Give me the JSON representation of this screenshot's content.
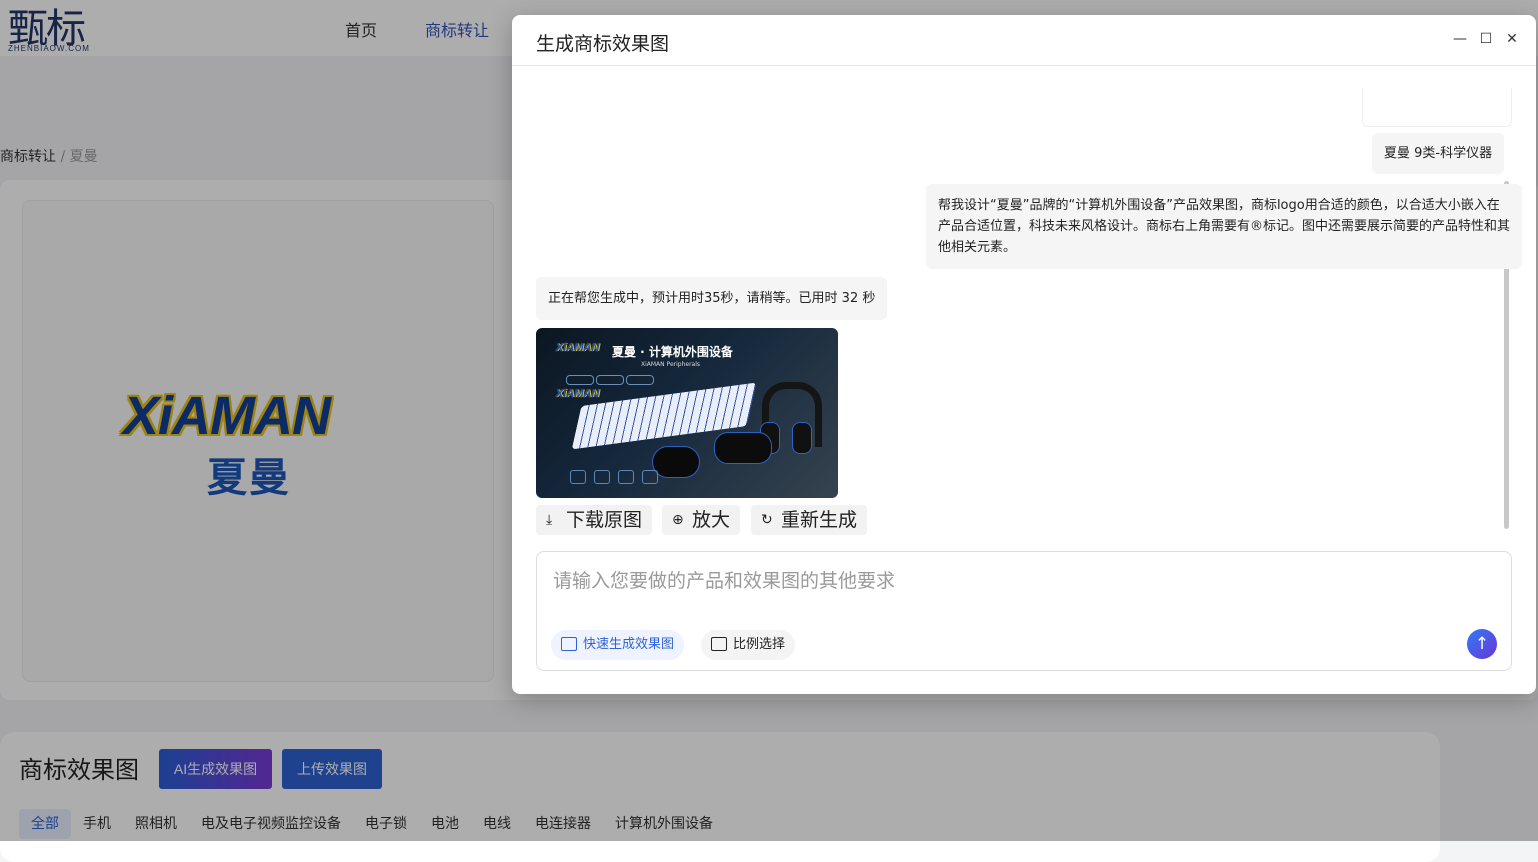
{
  "site": {
    "logo_cn": "甄标",
    "logo_en": "ZHENBIAOW.COM",
    "nav": [
      "首页",
      "商标转让"
    ],
    "breadcrumb": {
      "parent": "商标转让",
      "separator": "/",
      "current": "夏曼"
    },
    "brand_en": "XiAMAN",
    "brand_cn": "夏曼",
    "effects": {
      "title": "商标效果图",
      "ai_button": "AI生成效果图",
      "upload_button": "上传效果图",
      "categories": [
        "全部",
        "手机",
        "照相机",
        "电及电子视频监控设备",
        "电子锁",
        "电池",
        "电线",
        "电连接器",
        "计算机外围设备"
      ]
    }
  },
  "dialog": {
    "title": "生成商标效果图",
    "controls": {
      "minimize": "—",
      "maximize": "☐",
      "close": "✕"
    },
    "messages": {
      "category": "夏曼 9类-科学仪器",
      "request": "帮我设计“夏曼”品牌的“计算机外围设备”产品效果图，商标logo用合适的颜色，以合适大小嵌入在产品合适位置，科技未来风格设计。商标右上角需要有®标记。图中还需要展示简要的产品特性和其他相关元素。",
      "status": "正在帮您生成中，预计用时35秒，请稍等。已用时 32 秒"
    },
    "generated_image": {
      "logo_text": "XiAMAN",
      "title": "夏曼 · 计算机外围设备",
      "subtitle": "XiAMAN Peripherals"
    },
    "actions": {
      "download": "下载原图",
      "zoom": "放大",
      "regenerate": "重新生成"
    },
    "input": {
      "placeholder": "请输入您要做的产品和效果图的其他要求",
      "quick_generate": "快速生成效果图",
      "ratio_select": "比例选择"
    }
  },
  "colors": {
    "accent": "#2f62d3",
    "brand_blue": "#123f95",
    "brand_gold": "#e8c21b",
    "send_gradient_end": "#6a35d8"
  },
  "icons": [
    "download-icon",
    "zoom-in-icon",
    "refresh-icon",
    "image-icon",
    "ratio-icon",
    "arrow-up-icon"
  ]
}
